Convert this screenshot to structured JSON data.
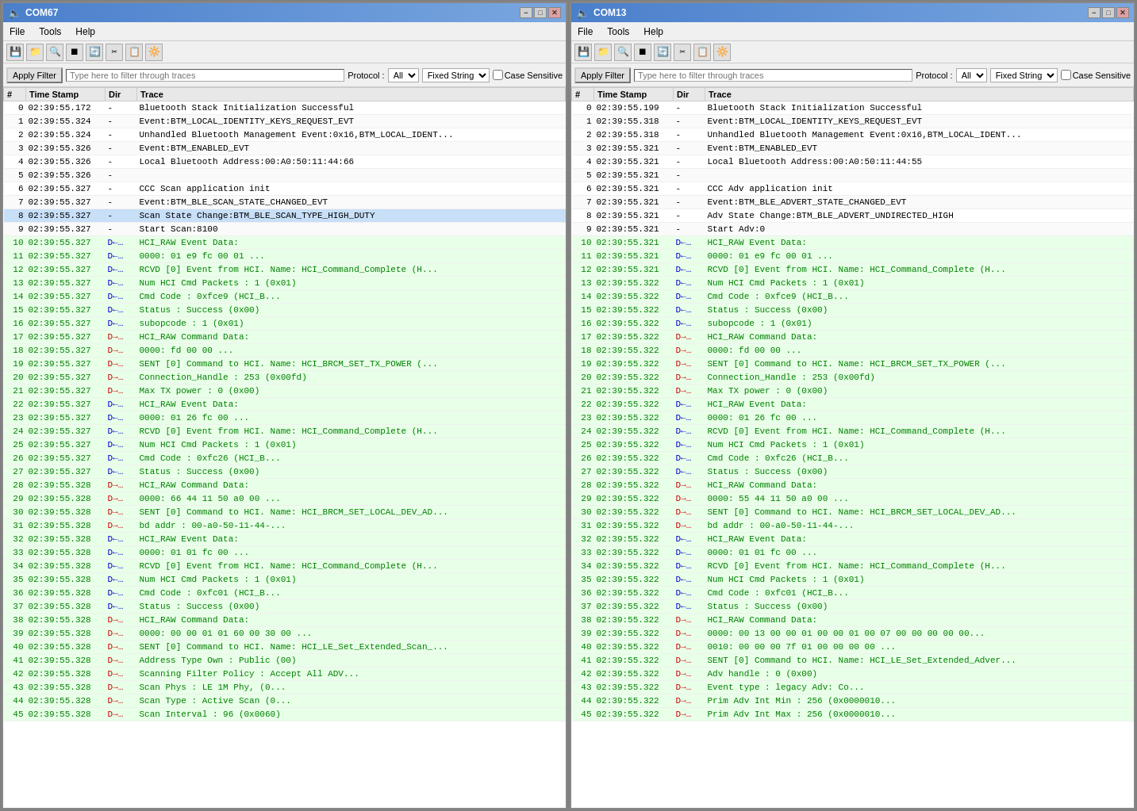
{
  "windows": [
    {
      "id": "left",
      "title": "COM67",
      "menus": [
        "File",
        "Tools",
        "Help"
      ],
      "filter": {
        "apply_label": "Apply Filter",
        "placeholder": "Type here to filter through traces",
        "protocol_label": "Protocol :",
        "protocol_value": "All",
        "fixed_string_value": "Fixed String",
        "case_sensitive_label": "Case Sensitive"
      },
      "columns": [
        "#",
        "Time Stamp",
        "Dir",
        "Trace"
      ],
      "rows": [
        {
          "num": "0",
          "time": "02:39:55.172",
          "dir": "-",
          "trace": "Bluetooth Stack Initialization Successful",
          "style": ""
        },
        {
          "num": "1",
          "time": "02:39:55.324",
          "dir": "-",
          "trace": "Event:BTM_LOCAL_IDENTITY_KEYS_REQUEST_EVT",
          "style": ""
        },
        {
          "num": "2",
          "time": "02:39:55.324",
          "dir": "-",
          "trace": "Unhandled Bluetooth Management Event:0x16,BTM_LOCAL_IDENT...",
          "style": ""
        },
        {
          "num": "3",
          "time": "02:39:55.326",
          "dir": "-",
          "trace": "Event:BTM_ENABLED_EVT",
          "style": ""
        },
        {
          "num": "4",
          "time": "02:39:55.326",
          "dir": "-",
          "trace": "Local Bluetooth Address:00:A0:50:11:44:66",
          "style": ""
        },
        {
          "num": "5",
          "time": "02:39:55.326",
          "dir": "-",
          "trace": "",
          "style": ""
        },
        {
          "num": "6",
          "time": "02:39:55.327",
          "dir": "-",
          "trace": "CCC Scan application init",
          "style": ""
        },
        {
          "num": "7",
          "time": "02:39:55.327",
          "dir": "-",
          "trace": "Event:BTM_BLE_SCAN_STATE_CHANGED_EVT",
          "style": ""
        },
        {
          "num": "8",
          "time": "02:39:55.327",
          "dir": "-",
          "trace": "Scan State Change:BTM_BLE_SCAN_TYPE_HIGH_DUTY",
          "style": "selected"
        },
        {
          "num": "9",
          "time": "02:39:55.327",
          "dir": "-",
          "trace": "Start Scan:8100",
          "style": ""
        },
        {
          "num": "10",
          "time": "02:39:55.327",
          "dir": "D←…",
          "trace": "HCI_RAW Event Data:",
          "style": "green"
        },
        {
          "num": "11",
          "time": "02:39:55.327",
          "dir": "D←…",
          "trace": "    0000: 01 e9 fc 00 01                             ...",
          "style": "green"
        },
        {
          "num": "12",
          "time": "02:39:55.327",
          "dir": "D←…",
          "trace": "RCVD [0] Event from HCI.  Name: HCI_Command_Complete   (H...",
          "style": "green"
        },
        {
          "num": "13",
          "time": "02:39:55.327",
          "dir": "D←…",
          "trace": "                  Num HCI Cmd Packets : 1 (0x01)",
          "style": "green"
        },
        {
          "num": "14",
          "time": "02:39:55.327",
          "dir": "D←…",
          "trace": "                       Cmd Code : 0xfce9  (HCI_B...",
          "style": "green"
        },
        {
          "num": "15",
          "time": "02:39:55.327",
          "dir": "D←…",
          "trace": "                     Status : Success (0x00)",
          "style": "green"
        },
        {
          "num": "16",
          "time": "02:39:55.327",
          "dir": "D←…",
          "trace": "                     subopcode : 1 (0x01)",
          "style": "green"
        },
        {
          "num": "17",
          "time": "02:39:55.327",
          "dir": "D→…",
          "trace": "HCI_RAW Command Data:",
          "style": "green"
        },
        {
          "num": "18",
          "time": "02:39:55.327",
          "dir": "D→…",
          "trace": "    0000: fd 00 00                                  ...",
          "style": "green"
        },
        {
          "num": "19",
          "time": "02:39:55.327",
          "dir": "D→…",
          "trace": "SENT [0] Command to HCI.  Name: HCI_BRCM_SET_TX_POWER   (...",
          "style": "green"
        },
        {
          "num": "20",
          "time": "02:39:55.327",
          "dir": "D→…",
          "trace": "             Connection_Handle : 253 (0x00fd)",
          "style": "green"
        },
        {
          "num": "21",
          "time": "02:39:55.327",
          "dir": "D→…",
          "trace": "                Max TX power : 0 (0x00)",
          "style": "green"
        },
        {
          "num": "22",
          "time": "02:39:55.327",
          "dir": "D←…",
          "trace": "HCI_RAW Event Data:",
          "style": "green"
        },
        {
          "num": "23",
          "time": "02:39:55.327",
          "dir": "D←…",
          "trace": "    0000: 01 26 fc 00                               ...",
          "style": "green"
        },
        {
          "num": "24",
          "time": "02:39:55.327",
          "dir": "D←…",
          "trace": "RCVD [0] Event from HCI.  Name: HCI_Command_Complete   (H...",
          "style": "green"
        },
        {
          "num": "25",
          "time": "02:39:55.327",
          "dir": "D←…",
          "trace": "                  Num HCI Cmd Packets : 1 (0x01)",
          "style": "green"
        },
        {
          "num": "26",
          "time": "02:39:55.327",
          "dir": "D←…",
          "trace": "                       Cmd Code : 0xfc26  (HCI_B...",
          "style": "green"
        },
        {
          "num": "27",
          "time": "02:39:55.327",
          "dir": "D←…",
          "trace": "                     Status : Success (0x00)",
          "style": "green"
        },
        {
          "num": "28",
          "time": "02:39:55.328",
          "dir": "D→…",
          "trace": "HCI_RAW Command Data:",
          "style": "green"
        },
        {
          "num": "29",
          "time": "02:39:55.328",
          "dir": "D→…",
          "trace": "    0000: 66 44 11 50 a0 00                          ...",
          "style": "green"
        },
        {
          "num": "30",
          "time": "02:39:55.328",
          "dir": "D→…",
          "trace": "SENT [0] Command to HCI.  Name: HCI_BRCM_SET_LOCAL_DEV_AD...",
          "style": "green"
        },
        {
          "num": "31",
          "time": "02:39:55.328",
          "dir": "D→…",
          "trace": "                   bd addr : 00-a0-50-11-44-...",
          "style": "green"
        },
        {
          "num": "32",
          "time": "02:39:55.328",
          "dir": "D←…",
          "trace": "HCI_RAW Event Data:",
          "style": "green"
        },
        {
          "num": "33",
          "time": "02:39:55.328",
          "dir": "D←…",
          "trace": "    0000: 01 01 fc 00                               ...",
          "style": "green"
        },
        {
          "num": "34",
          "time": "02:39:55.328",
          "dir": "D←…",
          "trace": "RCVD [0] Event from HCI.  Name: HCI_Command_Complete   (H...",
          "style": "green"
        },
        {
          "num": "35",
          "time": "02:39:55.328",
          "dir": "D←…",
          "trace": "                  Num HCI Cmd Packets : 1 (0x01)",
          "style": "green"
        },
        {
          "num": "36",
          "time": "02:39:55.328",
          "dir": "D←…",
          "trace": "                       Cmd Code : 0xfc01  (HCI_B...",
          "style": "green"
        },
        {
          "num": "37",
          "time": "02:39:55.328",
          "dir": "D←…",
          "trace": "                     Status : Success (0x00)",
          "style": "green"
        },
        {
          "num": "38",
          "time": "02:39:55.328",
          "dir": "D→…",
          "trace": "HCI_RAW Command Data:",
          "style": "green"
        },
        {
          "num": "39",
          "time": "02:39:55.328",
          "dir": "D→…",
          "trace": "    0000: 00 00 01 01 60 00 30 00                    ...",
          "style": "green"
        },
        {
          "num": "40",
          "time": "02:39:55.328",
          "dir": "D→…",
          "trace": "SENT [0] Command to HCI.  Name: HCI_LE_Set_Extended_Scan_...",
          "style": "green"
        },
        {
          "num": "41",
          "time": "02:39:55.328",
          "dir": "D→…",
          "trace": "                  Address Type Own : Public (00)",
          "style": "green"
        },
        {
          "num": "42",
          "time": "02:39:55.328",
          "dir": "D→…",
          "trace": "         Scanning Filter Policy : Accept All ADV...",
          "style": "green"
        },
        {
          "num": "43",
          "time": "02:39:55.328",
          "dir": "D→…",
          "trace": "              Scan Phys : LE 1M Phy,  (0...",
          "style": "green"
        },
        {
          "num": "44",
          "time": "02:39:55.328",
          "dir": "D→…",
          "trace": "              Scan Type : Active Scan (0...",
          "style": "green"
        },
        {
          "num": "45",
          "time": "02:39:55.328",
          "dir": "D→…",
          "trace": "              Scan Interval : 96 (0x0060)",
          "style": "green"
        }
      ]
    },
    {
      "id": "right",
      "title": "COM13",
      "menus": [
        "File",
        "Tools",
        "Help"
      ],
      "filter": {
        "apply_label": "Apply Filter",
        "placeholder": "Type here to filter through traces",
        "protocol_label": "Protocol :",
        "protocol_value": "All",
        "fixed_string_value": "Fixed String",
        "case_sensitive_label": "Case Sensitive"
      },
      "columns": [
        "#",
        "Time Stamp",
        "Dir",
        "Trace"
      ],
      "rows": [
        {
          "num": "0",
          "time": "02:39:55.199",
          "dir": "-",
          "trace": "Bluetooth Stack Initialization Successful",
          "style": ""
        },
        {
          "num": "1",
          "time": "02:39:55.318",
          "dir": "-",
          "trace": "Event:BTM_LOCAL_IDENTITY_KEYS_REQUEST_EVT",
          "style": ""
        },
        {
          "num": "2",
          "time": "02:39:55.318",
          "dir": "-",
          "trace": "Unhandled Bluetooth Management Event:0x16,BTM_LOCAL_IDENT...",
          "style": ""
        },
        {
          "num": "3",
          "time": "02:39:55.321",
          "dir": "-",
          "trace": "Event:BTM_ENABLED_EVT",
          "style": ""
        },
        {
          "num": "4",
          "time": "02:39:55.321",
          "dir": "-",
          "trace": "Local Bluetooth Address:00:A0:50:11:44:55",
          "style": ""
        },
        {
          "num": "5",
          "time": "02:39:55.321",
          "dir": "-",
          "trace": "",
          "style": ""
        },
        {
          "num": "6",
          "time": "02:39:55.321",
          "dir": "-",
          "trace": "CCC Adv application init",
          "style": ""
        },
        {
          "num": "7",
          "time": "02:39:55.321",
          "dir": "-",
          "trace": "Event:BTM_BLE_ADVERT_STATE_CHANGED_EVT",
          "style": ""
        },
        {
          "num": "8",
          "time": "02:39:55.321",
          "dir": "-",
          "trace": "Adv State Change:BTM_BLE_ADVERT_UNDIRECTED_HIGH",
          "style": ""
        },
        {
          "num": "9",
          "time": "02:39:55.321",
          "dir": "-",
          "trace": "Start Adv:0",
          "style": ""
        },
        {
          "num": "10",
          "time": "02:39:55.321",
          "dir": "D←…",
          "trace": "HCI_RAW Event Data:",
          "style": "green"
        },
        {
          "num": "11",
          "time": "02:39:55.321",
          "dir": "D←…",
          "trace": "    0000: 01 e9 fc 00 01                             ...",
          "style": "green"
        },
        {
          "num": "12",
          "time": "02:39:55.321",
          "dir": "D←…",
          "trace": "RCVD [0] Event from HCI.  Name: HCI_Command_Complete   (H...",
          "style": "green"
        },
        {
          "num": "13",
          "time": "02:39:55.322",
          "dir": "D←…",
          "trace": "                  Num HCI Cmd Packets : 1 (0x01)",
          "style": "green"
        },
        {
          "num": "14",
          "time": "02:39:55.322",
          "dir": "D←…",
          "trace": "                       Cmd Code : 0xfce9  (HCI_B...",
          "style": "green"
        },
        {
          "num": "15",
          "time": "02:39:55.322",
          "dir": "D←…",
          "trace": "                     Status : Success (0x00)",
          "style": "green"
        },
        {
          "num": "16",
          "time": "02:39:55.322",
          "dir": "D←…",
          "trace": "                     subopcode : 1 (0x01)",
          "style": "green"
        },
        {
          "num": "17",
          "time": "02:39:55.322",
          "dir": "D→…",
          "trace": "HCI_RAW Command Data:",
          "style": "green"
        },
        {
          "num": "18",
          "time": "02:39:55.322",
          "dir": "D→…",
          "trace": "    0000: fd 00 00                                  ...",
          "style": "green"
        },
        {
          "num": "19",
          "time": "02:39:55.322",
          "dir": "D→…",
          "trace": "SENT [0] Command to HCI.  Name: HCI_BRCM_SET_TX_POWER   (...",
          "style": "green"
        },
        {
          "num": "20",
          "time": "02:39:55.322",
          "dir": "D→…",
          "trace": "             Connection_Handle : 253 (0x00fd)",
          "style": "green"
        },
        {
          "num": "21",
          "time": "02:39:55.322",
          "dir": "D→…",
          "trace": "                Max TX power : 0 (0x00)",
          "style": "green"
        },
        {
          "num": "22",
          "time": "02:39:55.322",
          "dir": "D←…",
          "trace": "HCI_RAW Event Data:",
          "style": "green"
        },
        {
          "num": "23",
          "time": "02:39:55.322",
          "dir": "D←…",
          "trace": "    0000: 01 26 fc 00                               ...",
          "style": "green"
        },
        {
          "num": "24",
          "time": "02:39:55.322",
          "dir": "D←…",
          "trace": "RCVD [0] Event from HCI.  Name: HCI_Command_Complete   (H...",
          "style": "green"
        },
        {
          "num": "25",
          "time": "02:39:55.322",
          "dir": "D←…",
          "trace": "                  Num HCI Cmd Packets : 1 (0x01)",
          "style": "green"
        },
        {
          "num": "26",
          "time": "02:39:55.322",
          "dir": "D←…",
          "trace": "                       Cmd Code : 0xfc26  (HCI_B...",
          "style": "green"
        },
        {
          "num": "27",
          "time": "02:39:55.322",
          "dir": "D←…",
          "trace": "                     Status : Success (0x00)",
          "style": "green"
        },
        {
          "num": "28",
          "time": "02:39:55.322",
          "dir": "D→…",
          "trace": "HCI_RAW Command Data:",
          "style": "green"
        },
        {
          "num": "29",
          "time": "02:39:55.322",
          "dir": "D→…",
          "trace": "    0000: 55 44 11 50 a0 00                          ...",
          "style": "green"
        },
        {
          "num": "30",
          "time": "02:39:55.322",
          "dir": "D→…",
          "trace": "SENT [0] Command to HCI.  Name: HCI_BRCM_SET_LOCAL_DEV_AD...",
          "style": "green"
        },
        {
          "num": "31",
          "time": "02:39:55.322",
          "dir": "D→…",
          "trace": "                   bd addr : 00-a0-50-11-44-...",
          "style": "green"
        },
        {
          "num": "32",
          "time": "02:39:55.322",
          "dir": "D←…",
          "trace": "HCI_RAW Event Data:",
          "style": "green"
        },
        {
          "num": "33",
          "time": "02:39:55.322",
          "dir": "D←…",
          "trace": "    0000: 01 01 fc 00                               ...",
          "style": "green"
        },
        {
          "num": "34",
          "time": "02:39:55.322",
          "dir": "D←…",
          "trace": "RCVD [0] Event from HCI.  Name: HCI_Command_Complete   (H...",
          "style": "green"
        },
        {
          "num": "35",
          "time": "02:39:55.322",
          "dir": "D←…",
          "trace": "                  Num HCI Cmd Packets : 1 (0x01)",
          "style": "green"
        },
        {
          "num": "36",
          "time": "02:39:55.322",
          "dir": "D←…",
          "trace": "                       Cmd Code : 0xfc01  (HCI_B...",
          "style": "green"
        },
        {
          "num": "37",
          "time": "02:39:55.322",
          "dir": "D←…",
          "trace": "                     Status : Success (0x00)",
          "style": "green"
        },
        {
          "num": "38",
          "time": "02:39:55.322",
          "dir": "D→…",
          "trace": "HCI_RAW Command Data:",
          "style": "green"
        },
        {
          "num": "39",
          "time": "02:39:55.322",
          "dir": "D→…",
          "trace": "    0000: 00 13 00 00 01 00 00 01 00 07 00 00 00 00 00...",
          "style": "green"
        },
        {
          "num": "40",
          "time": "02:39:55.322",
          "dir": "D→…",
          "trace": "    0010: 00 00 00 7f 01 00 00 00 00                 ...",
          "style": "green"
        },
        {
          "num": "41",
          "time": "02:39:55.322",
          "dir": "D→…",
          "trace": "SENT [0] Command to HCI.  Name: HCI_LE_Set_Extended_Adver...",
          "style": "green"
        },
        {
          "num": "42",
          "time": "02:39:55.322",
          "dir": "D→…",
          "trace": "                       Adv handle : 0 (0x00)",
          "style": "green"
        },
        {
          "num": "43",
          "time": "02:39:55.322",
          "dir": "D→…",
          "trace": "             Event type : legacy Adv: Co...",
          "style": "green"
        },
        {
          "num": "44",
          "time": "02:39:55.322",
          "dir": "D→…",
          "trace": "              Prim Adv Int Min : 256 (0x0000010...",
          "style": "green"
        },
        {
          "num": "45",
          "time": "02:39:55.322",
          "dir": "D→…",
          "trace": "              Prim Adv Int Max : 256 (0x0000010...",
          "style": "green"
        }
      ]
    }
  ]
}
